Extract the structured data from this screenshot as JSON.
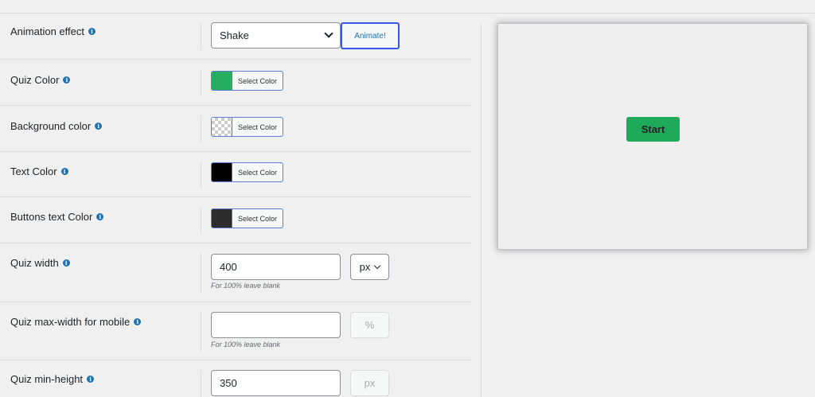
{
  "settings": {
    "animation_effect": {
      "label": "Animation effect",
      "value": "Shake",
      "button": "Animate!"
    },
    "quiz_color": {
      "label": "Quiz Color",
      "button": "Select Color",
      "color": "#27ae60"
    },
    "background_color": {
      "label": "Background color",
      "button": "Select Color",
      "color": "transparent"
    },
    "text_color": {
      "label": "Text Color",
      "button": "Select Color",
      "color": "#000000"
    },
    "buttons_text_color": {
      "label": "Buttons text Color",
      "button": "Select Color",
      "color": "#2c2c2c"
    },
    "quiz_width": {
      "label": "Quiz width",
      "value": "400",
      "unit": "px",
      "hint": "For 100% leave blank"
    },
    "quiz_max_width_mobile": {
      "label": "Quiz max-width for mobile",
      "value": "",
      "unit": "%",
      "hint": "For 100% leave blank"
    },
    "quiz_min_height": {
      "label": "Quiz min-height",
      "value": "350",
      "unit": "px"
    }
  },
  "preview": {
    "start_label": "Start",
    "button_color": "#1faa59"
  },
  "icons": {
    "info": "info-icon",
    "dropdown": "chevron-down-icon"
  }
}
